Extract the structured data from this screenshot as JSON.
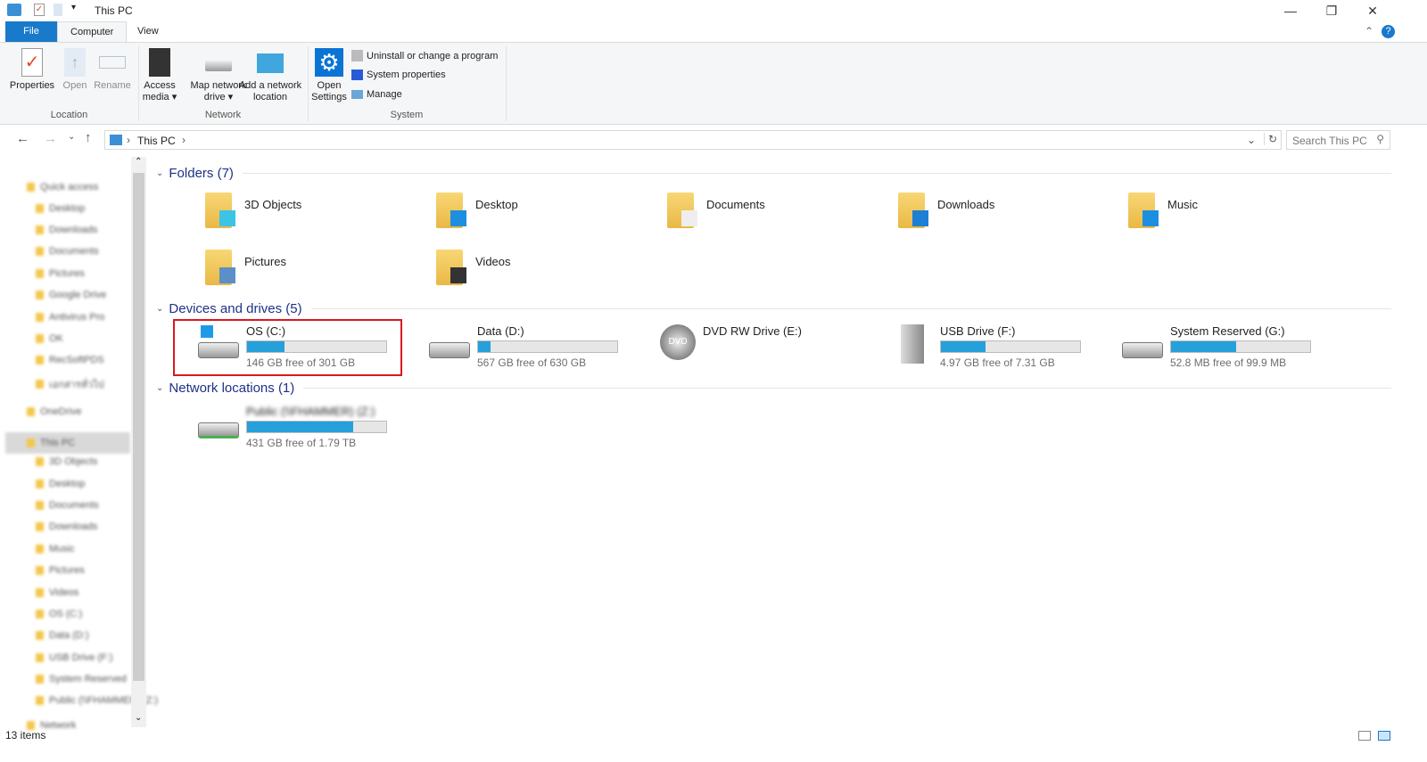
{
  "window": {
    "title": "This PC"
  },
  "tabs": [
    "File",
    "Computer",
    "View"
  ],
  "ribbon": {
    "location": {
      "label": "Location",
      "items": [
        "Properties",
        "Open",
        "Rename"
      ]
    },
    "network": {
      "label": "Network",
      "access": [
        "Access",
        "media"
      ],
      "map": [
        "Map network",
        "drive"
      ],
      "add": [
        "Add a network",
        "location"
      ]
    },
    "system": {
      "label": "System",
      "open": [
        "Open",
        "Settings"
      ],
      "uninstall": "Uninstall or change a program",
      "sysprops": "System properties",
      "manage": "Manage"
    }
  },
  "address": {
    "crumb": "This PC",
    "search_placeholder": "Search This PC"
  },
  "sidebar": {
    "items": [
      "Quick access",
      "Desktop",
      "Downloads",
      "Documents",
      "Pictures",
      "Google Drive",
      "Antivirus Pro",
      "OK",
      "RecSoftPDS",
      "เอกสารทั่วไป",
      "OneDrive",
      "This PC",
      "3D Objects",
      "Desktop",
      "Documents",
      "Downloads",
      "Music",
      "Pictures",
      "Videos",
      "OS (C:)",
      "Data (D:)",
      "USB Drive (F:)",
      "System Reserved",
      "Public (\\\\FHAMMER) (Z:)",
      "Network"
    ]
  },
  "folders": {
    "header": "Folders (7)",
    "items": [
      "3D Objects",
      "Desktop",
      "Documents",
      "Downloads",
      "Music",
      "Pictures",
      "Videos"
    ]
  },
  "drives": {
    "header": "Devices and drives (5)",
    "items": [
      {
        "name": "OS (C:)",
        "free": "146 GB free of 301 GB",
        "used": 0.27
      },
      {
        "name": "Data (D:)",
        "free": "567 GB free of 630 GB",
        "used": 0.09
      },
      {
        "name": "DVD RW Drive (E:)"
      },
      {
        "name": "USB Drive (F:)",
        "free": "4.97 GB free of 7.31 GB",
        "used": 0.32
      },
      {
        "name": "System Reserved (G:)",
        "free": "52.8 MB free of 99.9 MB",
        "used": 0.47
      }
    ]
  },
  "network": {
    "header": "Network locations (1)",
    "item": {
      "name": "Public (\\\\FHAMMER) (Z:)",
      "free": "431 GB free of 1.79 TB",
      "used": 0.76
    }
  },
  "status": "13 items",
  "colors": {
    "accent": "#1979ca",
    "bar": "#26a0da",
    "highlight": "#d9181f"
  }
}
